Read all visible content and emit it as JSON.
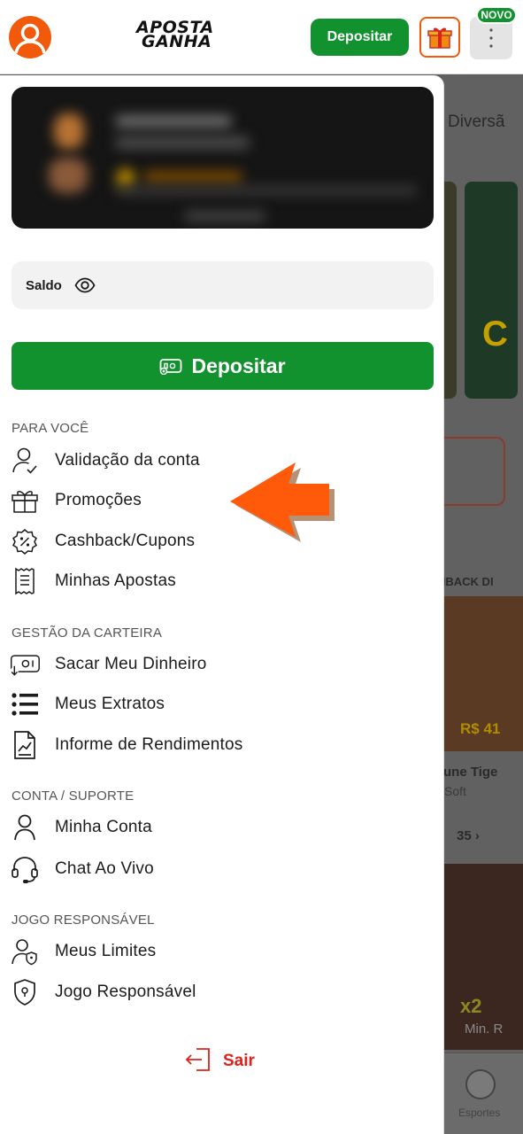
{
  "header": {
    "logo_line1": "APOSTA",
    "logo_line2": "GANHA",
    "deposit_label": "Depositar",
    "novo_badge": "NOVO",
    "accent": "#11922f",
    "brand": "#f05a0a"
  },
  "drawer": {
    "saldo_label": "Saldo",
    "deposit_label": "Depositar",
    "sections": [
      {
        "title": "PARA VOCÊ",
        "items": [
          {
            "label": "Validação da conta",
            "icon": "user-check-icon"
          },
          {
            "label": "Promoções",
            "icon": "gift-icon"
          },
          {
            "label": "Cashback/Cupons",
            "icon": "discount-badge-icon"
          },
          {
            "label": "Minhas Apostas",
            "icon": "receipt-icon"
          }
        ]
      },
      {
        "title": "GESTÃO DA CARTEIRA",
        "items": [
          {
            "label": "Sacar Meu Dinheiro",
            "icon": "withdraw-icon"
          },
          {
            "label": "Meus Extratos",
            "icon": "list-icon"
          },
          {
            "label": "Informe de Rendimentos",
            "icon": "report-icon"
          }
        ]
      },
      {
        "title": "CONTA / SUPORTE",
        "items": [
          {
            "label": "Minha Conta",
            "icon": "user-icon"
          },
          {
            "label": "Chat Ao Vivo",
            "icon": "headset-icon"
          }
        ]
      },
      {
        "title": "JOGO RESPONSÁVEL",
        "items": [
          {
            "label": "Meus Limites",
            "icon": "user-shield-icon"
          },
          {
            "label": "Jogo Responsável",
            "icon": "shield-icon"
          }
        ]
      }
    ],
    "logout_label": "Sair",
    "logout_color": "#e0201b"
  },
  "background": {
    "section_title": "Diversã",
    "cashback_heading": "HBACK DI",
    "thumb_amount": "R$ 41",
    "thumb_title": "tune Tige",
    "thumb_provider": "Soft",
    "count": "35",
    "thumb2_multiplier": "x2",
    "thumb2_min": "Min. R",
    "nav_esportes": "Esportes"
  }
}
